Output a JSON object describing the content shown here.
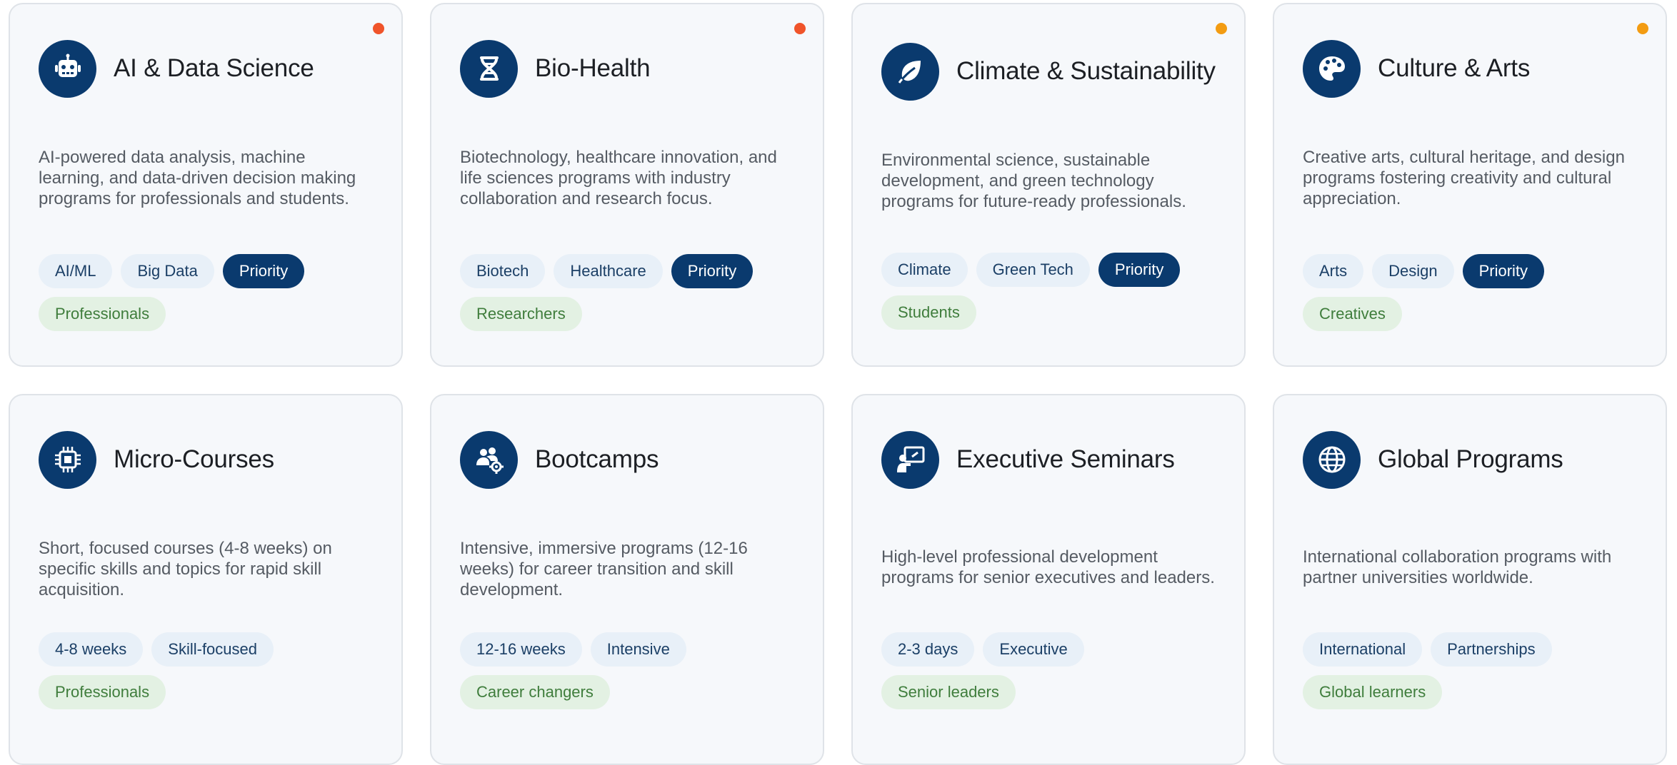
{
  "colors": {
    "icon_bg": "#0a3a6e",
    "dot_red": "#f0542a",
    "dot_orange": "#f39c12",
    "priority_bg": "#0a3a6e",
    "topic_bg": "#e8f0f8",
    "audience_bg": "#e3f1e3"
  },
  "cards": [
    {
      "title": "AI & Data Science",
      "icon": "robot-icon",
      "indicator": "red",
      "description": "AI-powered data analysis, machine learning, and data-driven decision making programs for professionals and students.",
      "tags": [
        "AI/ML",
        "Big Data"
      ],
      "priority_label": "Priority",
      "audience": "Professionals"
    },
    {
      "title": "Bio-Health",
      "icon": "dna-icon",
      "indicator": "red",
      "description": "Biotechnology, healthcare innovation, and life sciences programs with industry collaboration and research focus.",
      "tags": [
        "Biotech",
        "Healthcare"
      ],
      "priority_label": "Priority",
      "audience": "Researchers"
    },
    {
      "title": "Climate & Sustainability",
      "icon": "leaf-icon",
      "indicator": "orange",
      "description": "Environmental science, sustainable development, and green technology programs for future-ready professionals.",
      "tags": [
        "Climate",
        "Green Tech"
      ],
      "priority_label": "Priority",
      "audience": "Students"
    },
    {
      "title": "Culture & Arts",
      "icon": "palette-icon",
      "indicator": "orange",
      "description": "Creative arts, cultural heritage, and design programs fostering creativity and cultural appreciation.",
      "tags": [
        "Arts",
        "Design"
      ],
      "priority_label": "Priority",
      "audience": "Creatives"
    },
    {
      "title": "Micro-Courses",
      "icon": "chip-icon",
      "description": "Short, focused courses (4-8 weeks) on specific skills and topics for rapid skill acquisition.",
      "tags": [
        "4-8 weeks",
        "Skill-focused"
      ],
      "audience": "Professionals"
    },
    {
      "title": "Bootcamps",
      "icon": "users-gear-icon",
      "description": "Intensive, immersive programs (12-16 weeks) for career transition and skill development.",
      "tags": [
        "12-16 weeks",
        "Intensive"
      ],
      "audience": "Career changers"
    },
    {
      "title": "Executive Seminars",
      "icon": "presentation-icon",
      "description": "High-level professional development programs for senior executives and leaders.",
      "tags": [
        "2-3 days",
        "Executive"
      ],
      "audience": "Senior leaders"
    },
    {
      "title": "Global Programs",
      "icon": "globe-icon",
      "description": "International collaboration programs with partner universities worldwide.",
      "tags": [
        "International",
        "Partnerships"
      ],
      "audience": "Global learners"
    }
  ]
}
